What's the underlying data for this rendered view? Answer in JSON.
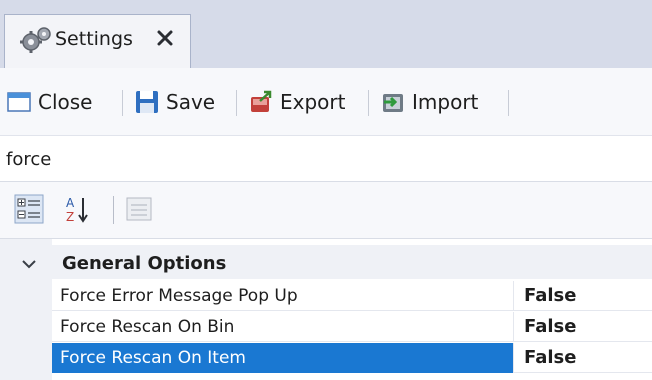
{
  "tab": {
    "label": "Settings",
    "icon": "gears-icon",
    "close_icon": "close-icon"
  },
  "toolbar": {
    "buttons": [
      {
        "label": "Close",
        "icon": "window-close-icon"
      },
      {
        "label": "Save",
        "icon": "floppy-disk-icon"
      },
      {
        "label": "Export",
        "icon": "export-icon"
      },
      {
        "label": "Import",
        "icon": "import-icon"
      }
    ]
  },
  "search": {
    "value": "force"
  },
  "property_grid": {
    "toolbar_icons": [
      "categorized-icon",
      "sort-alphabetical-icon",
      "property-pages-icon"
    ],
    "category": {
      "label": "General Options",
      "expanded": true
    },
    "rows": [
      {
        "name": "Force Error Message Pop Up",
        "value": "False",
        "selected": false
      },
      {
        "name": "Force Rescan On Bin",
        "value": "False",
        "selected": false
      },
      {
        "name": "Force Rescan On Item",
        "value": "False",
        "selected": true
      }
    ]
  },
  "colors": {
    "selection": "#1a78d2",
    "tab_band": "#d6dbe9",
    "category_bg": "#eff1f6"
  }
}
